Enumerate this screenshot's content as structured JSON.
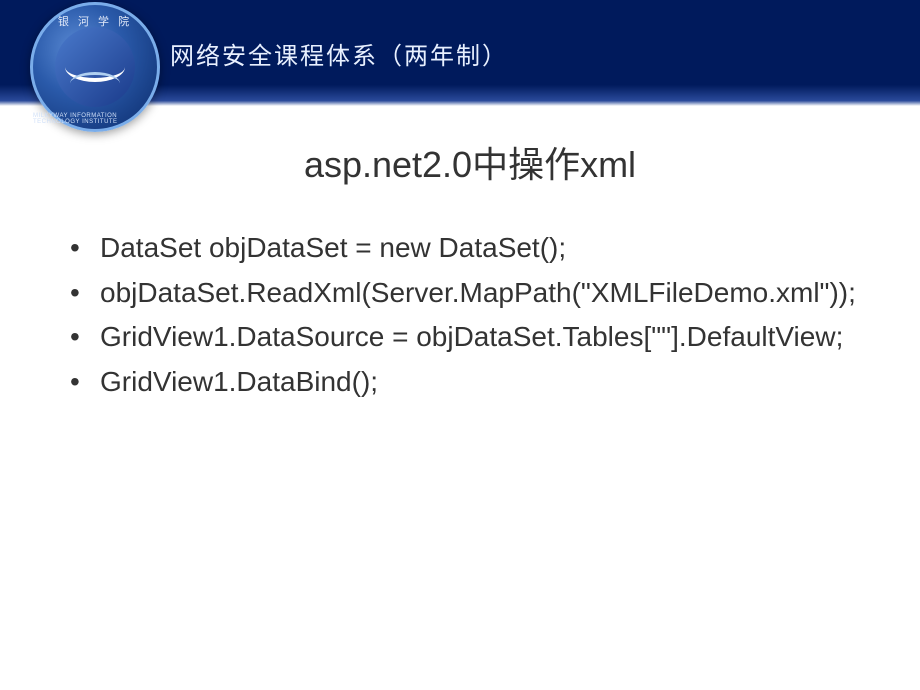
{
  "header": {
    "logo_top_text": "银 河 学 院",
    "logo_bottom_text": "MILKYWAY INFORMATION TECHNOLOGY INSTITUTE",
    "title": "网络安全课程体系（两年制）"
  },
  "slide": {
    "title": "asp.net2.0中操作xml",
    "bullets": [
      "DataSet objDataSet = new DataSet();",
      " objDataSet.ReadXml(Server.MapPath(\"XMLFileDemo.xml\"));",
      "GridView1.DataSource = objDataSet.Tables[\"\"].DefaultView;",
      "GridView1.DataBind();"
    ]
  }
}
